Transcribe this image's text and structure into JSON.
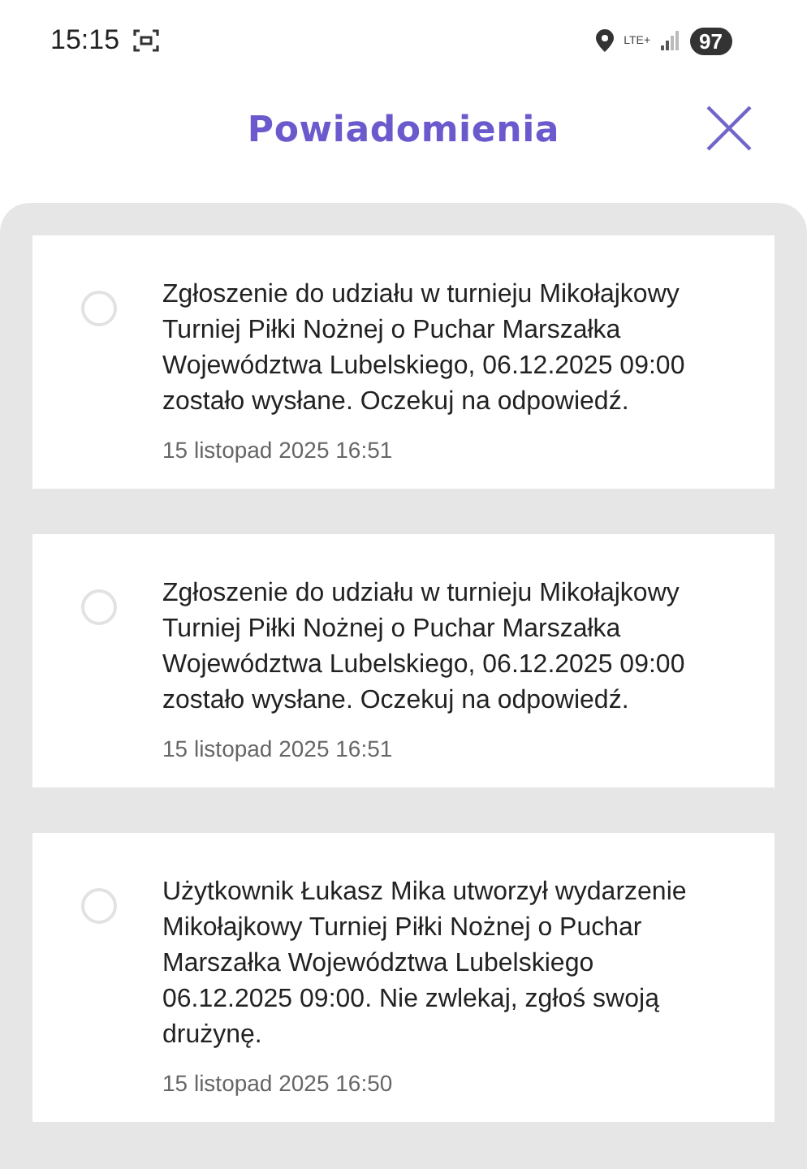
{
  "status_bar": {
    "time": "15:15",
    "network": "LTE+",
    "battery": "97"
  },
  "header": {
    "title": "Powiadomienia"
  },
  "notifications": [
    {
      "selected": false,
      "message": "Zgłoszenie do udziału w turnieju Mikołajkowy Turniej Piłki Nożnej o Puchar Marszałka Województwa Lubelskiego, 06.12.2025 09:00 zostało wysłane. Oczekuj na odpowiedź.",
      "time": "15 listopad 2025 16:51"
    },
    {
      "selected": false,
      "message": "Zgłoszenie do udziału w turnieju Mikołajkowy Turniej Piłki Nożnej o Puchar Marszałka Województwa Lubelskiego, 06.12.2025 09:00 zostało wysłane. Oczekuj na odpowiedź.",
      "time": "15 listopad 2025 16:51"
    },
    {
      "selected": false,
      "message": "Użytkownik Łukasz Mika utworzył wydarzenie Mikołajkowy Turniej Piłki Nożnej o Puchar Marszałka Województwa Lubelskiego 06.12.2025 09:00. Nie zwlekaj, zgłoś swoją drużynę.",
      "time": "15 listopad 2025 16:50"
    }
  ]
}
